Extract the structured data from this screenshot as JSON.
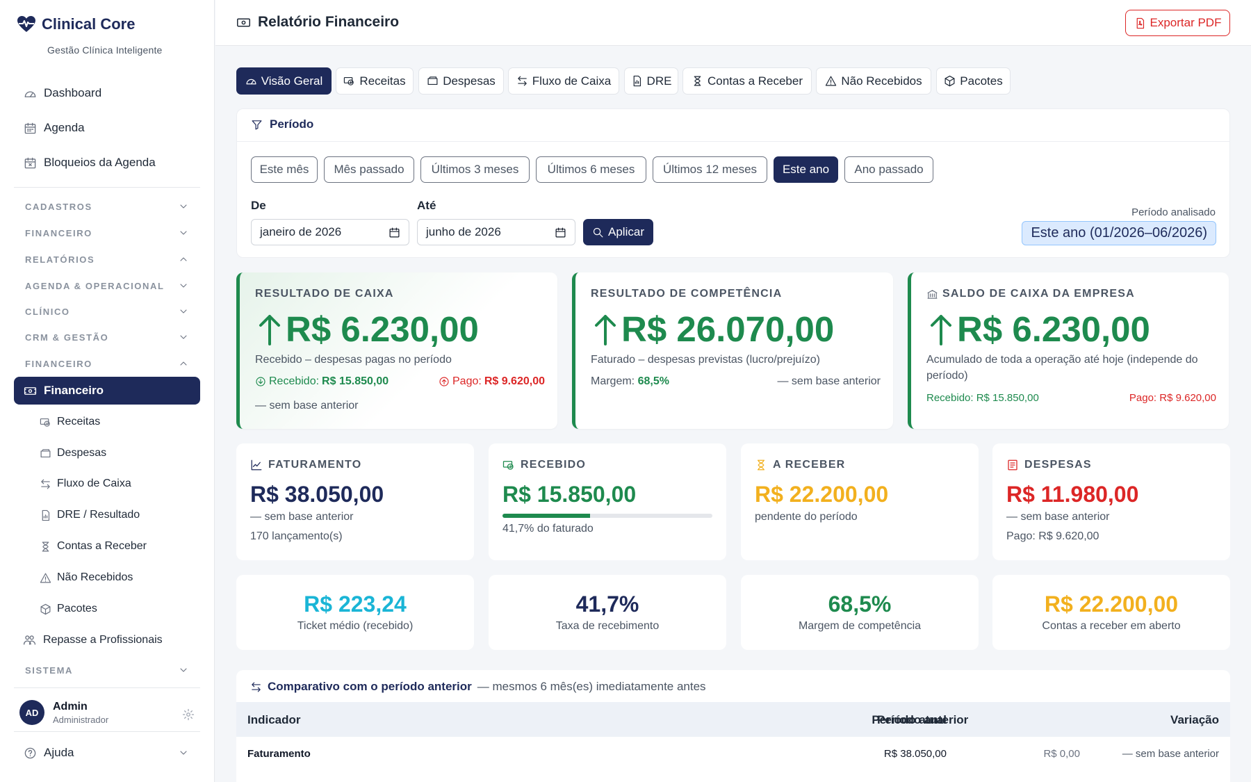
{
  "brand": {
    "title": "Clinical Core",
    "subtitle": "Gestão Clínica Inteligente",
    "icon": "heart-pulse-icon",
    "color": "#1e2a5a"
  },
  "sidebar": {
    "top_items": [
      {
        "label": "Dashboard",
        "icon": "gauge-icon"
      },
      {
        "label": "Agenda",
        "icon": "calendar-icon"
      },
      {
        "label": "Bloqueios da Agenda",
        "icon": "calendar-x-icon"
      }
    ],
    "sections": [
      {
        "label": "CADASTROS",
        "state": "collapsed"
      },
      {
        "label": "FINANCEIRO",
        "state": "collapsed"
      },
      {
        "label": "RELATÓRIOS",
        "state": "expanded"
      },
      {
        "label": "AGENDA & OPERACIONAL",
        "state": "collapsed"
      },
      {
        "label": "CLÍNICO",
        "state": "collapsed"
      },
      {
        "label": "CRM & GESTÃO",
        "state": "collapsed"
      },
      {
        "label": "FINANCEIRO",
        "state": "expanded"
      }
    ],
    "active_item": {
      "label": "Financeiro",
      "icon": "money-icon"
    },
    "sub_items": [
      {
        "label": "Receitas",
        "icon": "cash-icon"
      },
      {
        "label": "Despesas",
        "icon": "wallet-icon"
      },
      {
        "label": "Fluxo de Caixa",
        "icon": "arrows-swap-icon"
      },
      {
        "label": "DRE / Resultado",
        "icon": "report-icon"
      },
      {
        "label": "Contas a Receber",
        "icon": "hourglass-icon"
      },
      {
        "label": "Não Recebidos",
        "icon": "warning-icon"
      },
      {
        "label": "Pacotes",
        "icon": "box-icon"
      }
    ],
    "repasse": {
      "label": "Repasse a Profissionais",
      "icon": "people-icon"
    },
    "sistema": {
      "label": "SISTEMA",
      "state": "collapsed"
    },
    "user": {
      "initials": "AD",
      "name": "Admin",
      "role": "Administrador"
    },
    "help": {
      "label": "Ajuda",
      "icon": "question-icon"
    }
  },
  "header": {
    "title": "Relatório Financeiro",
    "export_label": "Exportar PDF",
    "export_color": "#dc2626"
  },
  "tabs": [
    {
      "label": "Visão Geral",
      "icon": "gauge-icon",
      "active": true
    },
    {
      "label": "Receitas",
      "icon": "cash-icon"
    },
    {
      "label": "Despesas",
      "icon": "wallet-icon"
    },
    {
      "label": "Fluxo de Caixa",
      "icon": "arrows-swap-icon"
    },
    {
      "label": "DRE",
      "icon": "report-icon"
    },
    {
      "label": "Contas a Receber",
      "icon": "hourglass-icon"
    },
    {
      "label": "Não Recebidos",
      "icon": "warning-icon"
    },
    {
      "label": "Pacotes",
      "icon": "box-icon"
    }
  ],
  "period": {
    "title": "Período",
    "presets": [
      {
        "label": "Este mês"
      },
      {
        "label": "Mês passado"
      },
      {
        "label": "Últimos 3 meses"
      },
      {
        "label": "Últimos 6 meses"
      },
      {
        "label": "Últimos 12 meses"
      },
      {
        "label": "Este ano",
        "active": true
      },
      {
        "label": "Ano passado"
      }
    ],
    "from_label": "De",
    "from_value": "janeiro de 2026",
    "to_label": "Até",
    "to_value": "junho de 2026",
    "apply_label": "Aplicar",
    "analyzed_label": "Período analisado",
    "analyzed_value": "Este ano (01/2026–06/2026)"
  },
  "results": [
    {
      "label": "RESULTADO DE CAIXA",
      "value": "R$ 6.230,00",
      "desc": "Recebido – despesas pagas no período",
      "received_label": "Recebido:",
      "received_value": "R$ 15.850,00",
      "paid_label": "Pago:",
      "paid_value": "R$ 9.620,00",
      "note": "— sem base anterior"
    },
    {
      "label": "RESULTADO DE COMPETÊNCIA",
      "value": "R$ 26.070,00",
      "desc": "Faturado – despesas previstas (lucro/prejuízo)",
      "margin_label": "Margem:",
      "margin_value": "68,5%",
      "note": "— sem base anterior"
    },
    {
      "label": "SALDO DE CAIXA DA EMPRESA",
      "icon": "bank-icon",
      "value": "R$ 6.230,00",
      "desc": "Acumulado de toda a operação até hoje (independe do período)",
      "received": "Recebido: R$ 15.850,00",
      "paid": "Pago: R$ 9.620,00"
    }
  ],
  "metrics": [
    {
      "label": "FATURAMENTO",
      "icon": "chart-line-icon",
      "value": "R$ 38.050,00",
      "color": "#1e2a5a",
      "line1": "— sem base anterior",
      "line2": "170 lançamento(s)"
    },
    {
      "label": "RECEBIDO",
      "icon": "cash-icon",
      "value": "R$ 15.850,00",
      "color": "#1e8a4e",
      "progress": 0.417,
      "line1": "41,7% do faturado"
    },
    {
      "label": "A RECEBER",
      "icon": "hourglass-icon",
      "value": "R$ 22.200,00",
      "color": "#f2b01e",
      "line1": "pendente do período"
    },
    {
      "label": "DESPESAS",
      "icon": "receipt-icon",
      "value": "R$ 11.980,00",
      "color": "#dc2626",
      "line1": "— sem base anterior",
      "line2": "Pago: R$ 9.620,00"
    }
  ],
  "kpis": [
    {
      "value": "R$ 223,24",
      "label": "Ticket médio (recebido)",
      "color": "#1ab5d6"
    },
    {
      "value": "41,7%",
      "label": "Taxa de recebimento",
      "color": "#1e2a5a"
    },
    {
      "value": "68,5%",
      "label": "Margem de competência",
      "color": "#1e8a4e"
    },
    {
      "value": "R$ 22.200,00",
      "label": "Contas a receber em aberto",
      "color": "#f2b01e"
    }
  ],
  "comparison": {
    "title": "Comparativo com o período anterior",
    "note": "— mesmos 6 mês(es) imediatamente antes",
    "columns": [
      "Indicador",
      "Período atual",
      "Período anterior",
      "Variação"
    ],
    "rows": [
      {
        "indicator": "Faturamento",
        "current": "R$ 38.050,00",
        "previous": "R$ 0,00",
        "variation": "— sem base anterior"
      }
    ]
  }
}
